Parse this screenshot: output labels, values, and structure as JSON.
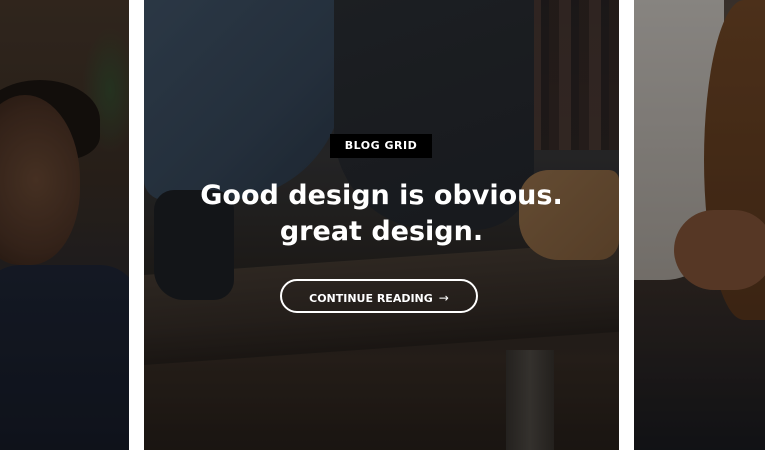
{
  "hero": {
    "category": "BLOG GRID",
    "title_line1": "Good design is obvious.",
    "title_line2": "great design.",
    "cta_label": "CONTINUE READING",
    "cta_icon": "arrow-right-icon"
  },
  "colors": {
    "page_background": "#ffffff",
    "category_background": "#000000",
    "text": "#ffffff",
    "button_border": "#ffffff"
  }
}
